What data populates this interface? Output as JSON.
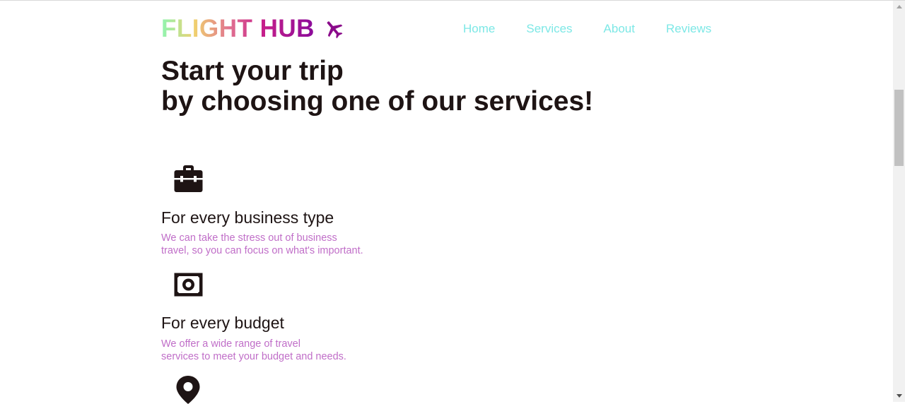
{
  "header": {
    "logo_text": "FLIGHT HUB",
    "logo_icon": "plane-icon",
    "nav": [
      {
        "label": "Home"
      },
      {
        "label": "Services"
      },
      {
        "label": "About"
      },
      {
        "label": "Reviews"
      }
    ]
  },
  "hero": {
    "line1": "Start your trip",
    "line2": "by choosing one of our services!"
  },
  "services": [
    {
      "icon": "briefcase-icon",
      "title": "For every business type",
      "desc_line1": "We can take the stress out of business",
      "desc_line2": "travel, so you can focus on what's important."
    },
    {
      "icon": "money-bill-icon",
      "title": "For every budget",
      "desc_line1": "We offer a wide range of travel",
      "desc_line2": "services to meet your budget and needs."
    },
    {
      "icon": "map-pin-icon"
    }
  ],
  "colors": {
    "nav_link": "#7de8e6",
    "heading": "#1e1414",
    "description": "#c06ec8",
    "plane": "#8a0a8a"
  }
}
